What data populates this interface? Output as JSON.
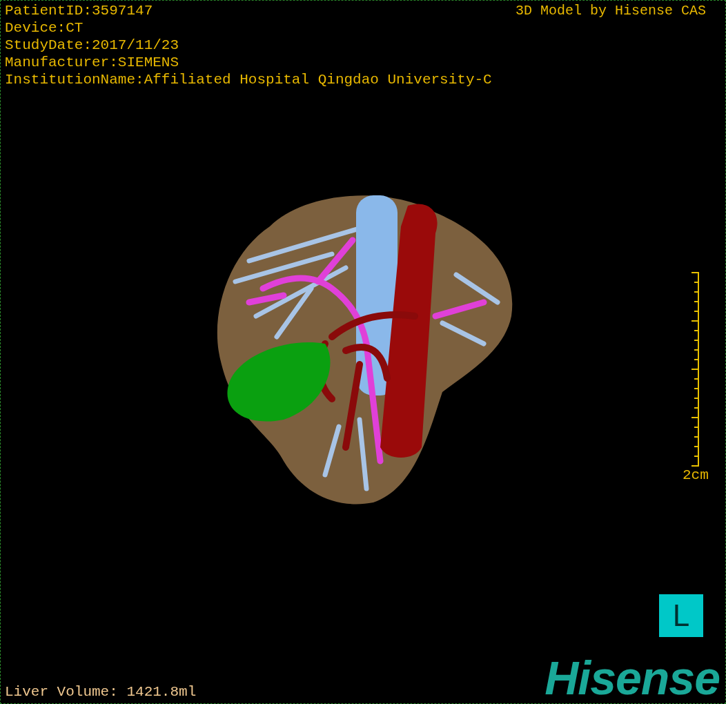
{
  "viewer": {
    "patient_info": [
      "PatientID:3597147",
      "Device:CT",
      "StudyDate:2017/11/23",
      "Manufacturer:SIEMENS",
      "InstitutionName:Affiliated Hospital Qingdao University-C"
    ],
    "credit": "3D Model by Hisense CAS",
    "scale_label": "2cm",
    "orientation_marker": "L",
    "liver_volume": "Liver Volume: 1421.8ml",
    "logo": "Hisense"
  }
}
